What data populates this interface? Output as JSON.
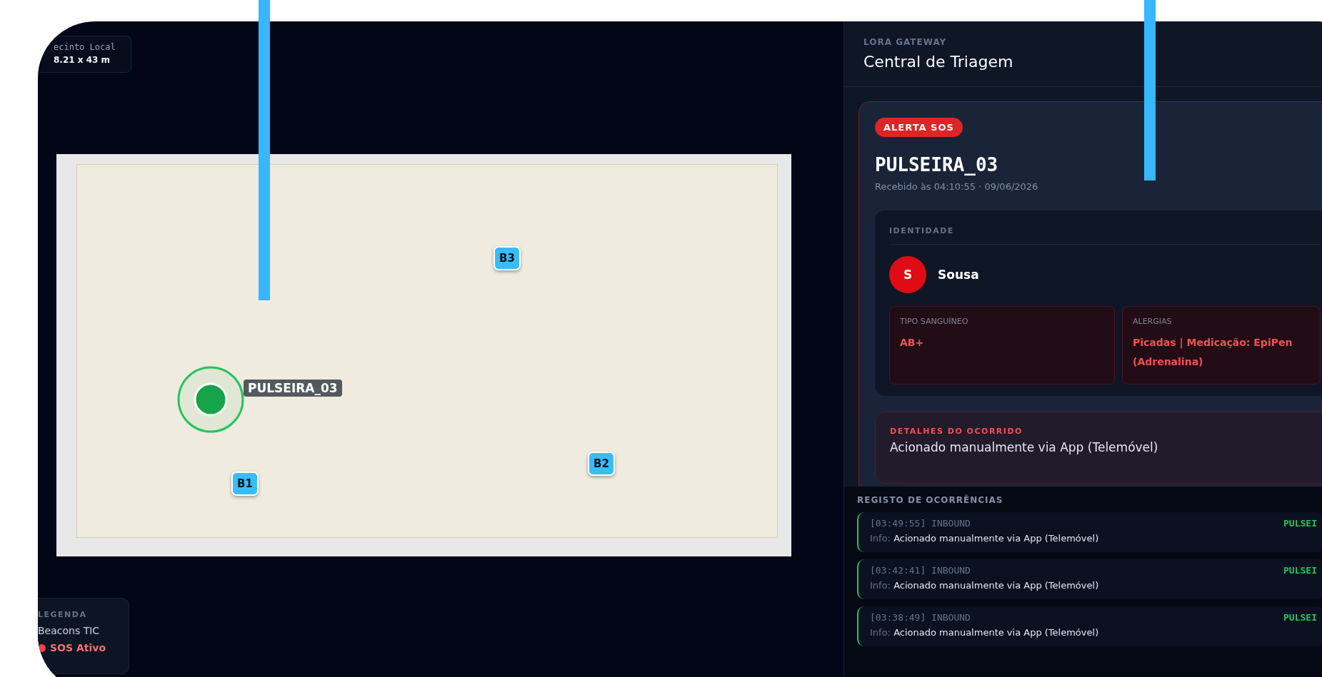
{
  "map_overlay": {
    "area_label": "ecinto Local",
    "area_size": "8.21 x 43 m"
  },
  "map": {
    "beacons": [
      {
        "label": "B3"
      },
      {
        "label": "B2"
      },
      {
        "label": "B1"
      }
    ],
    "wristband": {
      "label": "PULSEIRA_03"
    }
  },
  "legend": {
    "title": "LEGENDA",
    "items": [
      {
        "kind": "beacon",
        "label": "Beacons TIC"
      },
      {
        "kind": "sos",
        "label": "SOS Ativo"
      }
    ]
  },
  "gateway": {
    "overline": "LORA GATEWAY",
    "title": "Central de Triagem"
  },
  "alert": {
    "badge": "ALERTA SOS",
    "device": "PULSEIRA_03",
    "received": "Recebido às 04:10:55 · 09/06/2026",
    "identity": {
      "heading": "IDENTIDADE",
      "initial": "S",
      "name": "Sousa",
      "fields": [
        {
          "label": "TIPO SANGUÍNEO",
          "value": "AB+"
        },
        {
          "label": "ALERGIAS",
          "value": "Picadas | Medicação: EpiPen (Adrenalina)"
        }
      ]
    },
    "details": {
      "heading": "DETALHES DO OCORRIDO",
      "text": "Acionado manualmente via App (Telemóvel)"
    }
  },
  "log": {
    "title": "REGISTO DE OCORRÊNCIAS",
    "entries": [
      {
        "time": "[03:49:55] INBOUND",
        "info_label": "Info:",
        "message": "Acionado manualmente via App (Telemóvel)",
        "device": "PULSEI"
      },
      {
        "time": "[03:42:41] INBOUND",
        "info_label": "Info:",
        "message": "Acionado manualmente via App (Telemóvel)",
        "device": "PULSEI"
      },
      {
        "time": "[03:38:49] INBOUND",
        "info_label": "Info:",
        "message": "Acionado manualmente via App (Telemóvel)",
        "device": "PULSEI"
      }
    ]
  }
}
